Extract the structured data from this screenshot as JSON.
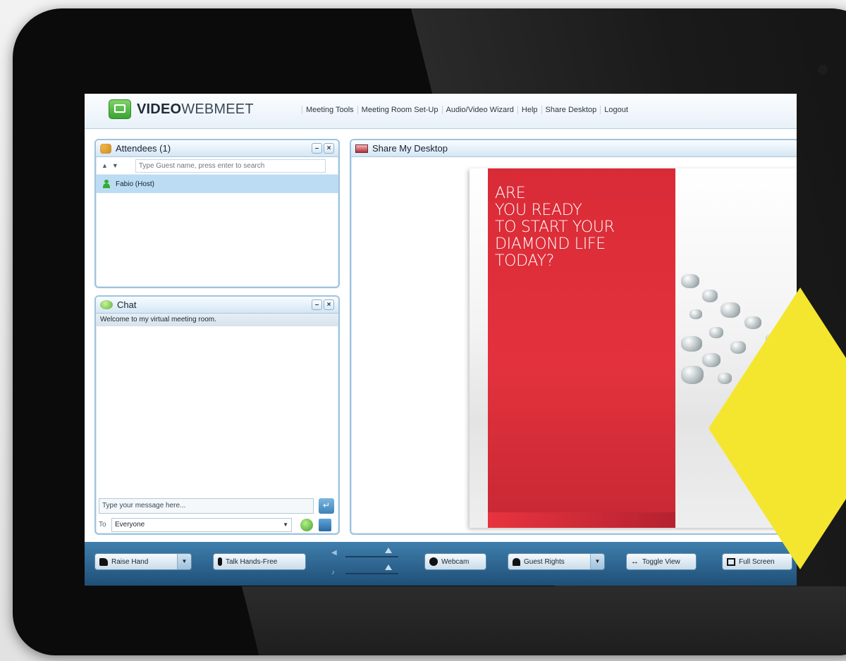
{
  "app": {
    "logo_bold": "VIDEO",
    "logo_thin": "WEBMEET",
    "nav": [
      "Meeting Tools",
      "Meeting Room Set-Up",
      "Audio/Video Wizard",
      "Help",
      "Share Desktop",
      "Logout"
    ]
  },
  "attendees": {
    "title": "Attendees (1)",
    "search_placeholder": "Type Guest name, press enter to search",
    "list": [
      "Fabio (Host)"
    ]
  },
  "chat": {
    "title": "Chat",
    "welcome": "Welcome to my virtual meeting room.",
    "input_placeholder": "Type your message here...",
    "to_label": "To",
    "recipient": "Everyone"
  },
  "share": {
    "title": "Share My Desktop",
    "headline": [
      "ARE",
      "YOU READY",
      "TO START YOUR",
      "DIAMOND LIFE",
      "TODAY?"
    ]
  },
  "toolbar": {
    "raise_hand": "Raise Hand",
    "talk": "Talk Hands-Free",
    "webcam": "Webcam",
    "guest_rights": "Guest Rights",
    "toggle_view": "Toggle View",
    "full_screen": "Full Screen"
  },
  "colors": {
    "accent_blue": "#3f7fad",
    "red_panel": "#e3323d",
    "yellow_shape": "#f4e62e",
    "logo_green": "#3ca232"
  },
  "icons": {
    "logo": "presentation-screen-icon",
    "attendees": "people-icon",
    "chat": "speech-bubble-icon",
    "share": "monitor-icon",
    "raise_hand": "thumbs-up-icon",
    "talk": "microphone-icon",
    "webcam": "webcam-icon",
    "guest_rights": "user-icon",
    "toggle_view": "double-arrow-icon",
    "full_screen": "fullscreen-icon"
  }
}
